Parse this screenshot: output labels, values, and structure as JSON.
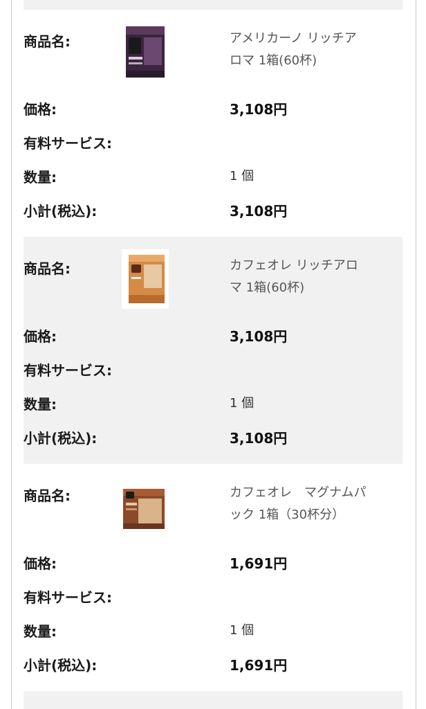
{
  "labels": {
    "name": "商品名:",
    "price": "価格:",
    "paid_service": "有料サービス:",
    "quantity": "数量:",
    "subtotal": "小計(税込):"
  },
  "items": [
    {
      "name_line1": "アメリカーノ リッチア",
      "name_line2": "ロマ 1箱(60杯)",
      "price": "3,108円",
      "paid_service": "",
      "quantity": "1 個",
      "subtotal": "3,108円",
      "box_color": "#4a2d4a"
    },
    {
      "name_line1": "カフェオレ リッチアロ",
      "name_line2": "マ 1箱(60杯)",
      "price": "3,108円",
      "paid_service": "",
      "quantity": "1 個",
      "subtotal": "3,108円",
      "box_color": "#c9864a"
    },
    {
      "name_line1": "カフェオレ　マグナムパ",
      "name_line2": "ック 1箱（30杯分）",
      "price": "1,691円",
      "paid_service": "",
      "quantity": "1 個",
      "subtotal": "1,691円",
      "box_color": "#a0522d"
    }
  ]
}
